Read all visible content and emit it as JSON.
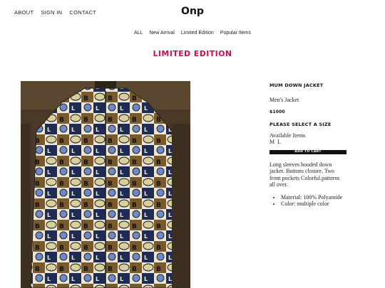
{
  "header": {
    "nav": [
      "ABOUT",
      "SIGN IN",
      "CONTACT"
    ],
    "brand": "Onp"
  },
  "categories": [
    "ALL",
    "New Arrival",
    "Limited Edition",
    "Popular Items"
  ],
  "page_title": "LIMITED EDITION",
  "product": {
    "name": "MUM DOWN JACKET",
    "type": "Men's Jacket",
    "price": "$1000",
    "size_heading": "PLEASE SELECT A SIZE",
    "available_label": "Available Items",
    "sizes": [
      "M",
      "L"
    ],
    "cart_label": "ADD TO CART",
    "description": "Long sleeves hooded down jacket. Buttons closure. Two front pockets Colorful.patterns all over.",
    "features": [
      "Material: 100% Polyamide",
      "Color: multiple color"
    ]
  },
  "colors": {
    "accent": "#c4124a",
    "button": "#111111"
  }
}
